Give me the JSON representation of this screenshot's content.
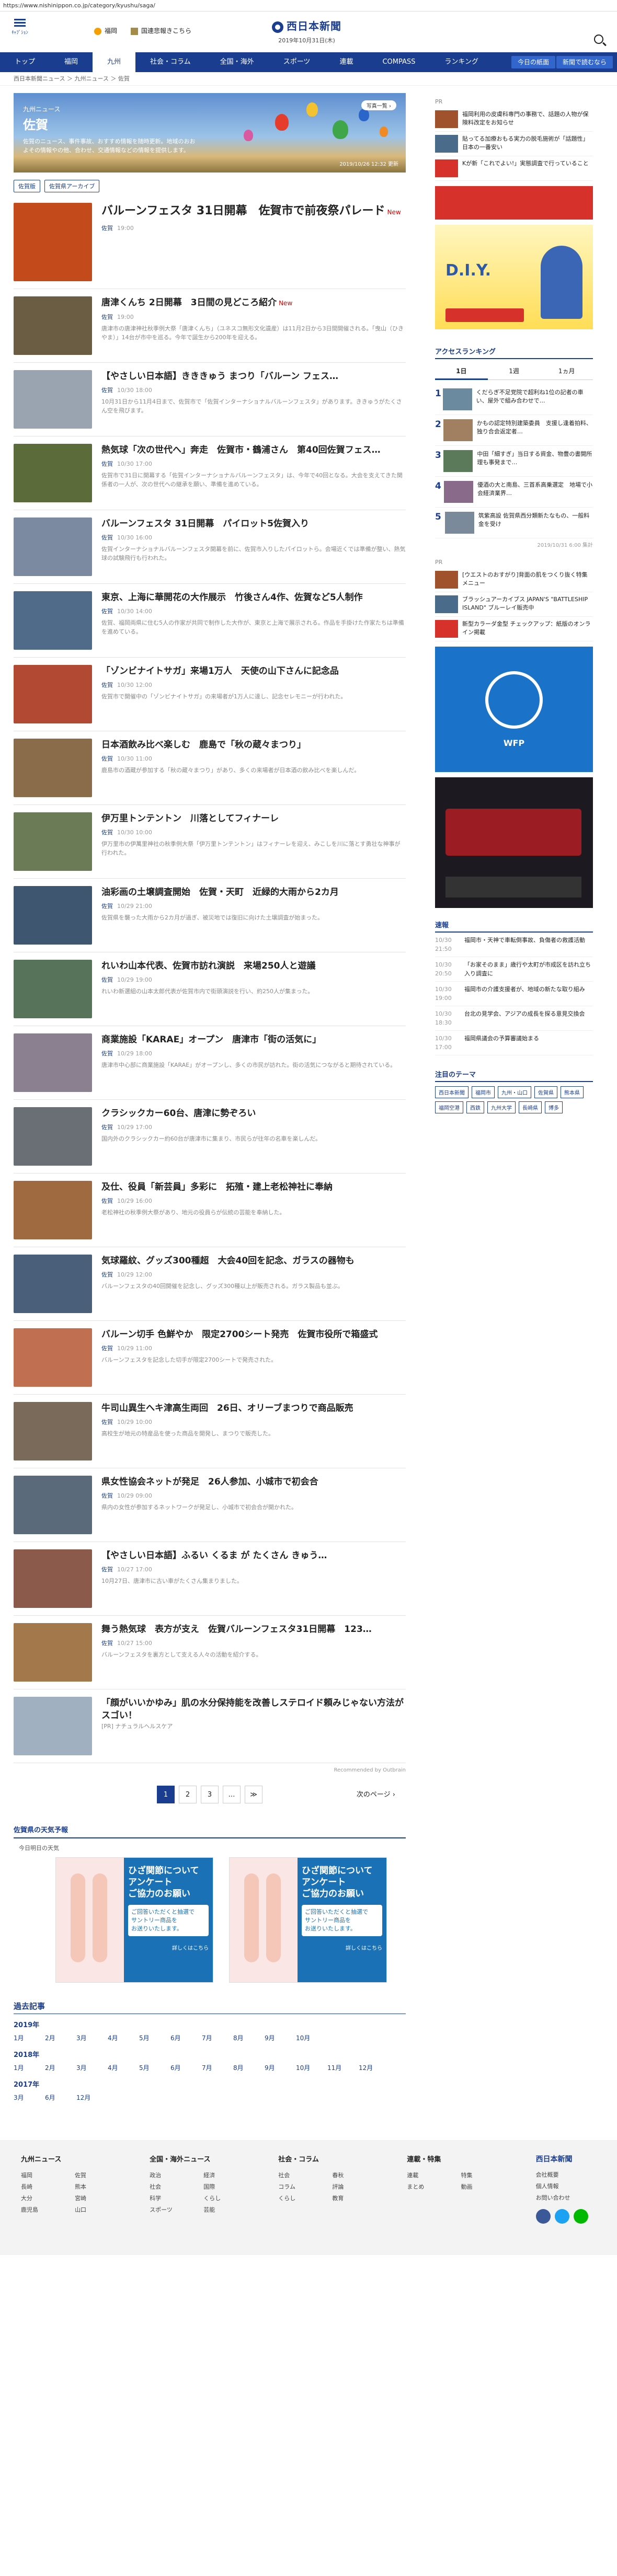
{
  "url": "https://www.nishinippon.co.jp/category/kyushu/saga/",
  "header": {
    "menu_label": "ｷｬﾌﾟｼｮﾝ",
    "weather1": "福岡",
    "weather2": "国連悲報きこちら",
    "logo": "西日本新聞",
    "date": "2019年10月31日(木)"
  },
  "nav": {
    "items": [
      "トップ",
      "福岡",
      "九州",
      "社会・コラム",
      "全国・海外",
      "スポーツ",
      "連載",
      "COMPASS",
      "ランキング"
    ],
    "btn1": "今日の紙面",
    "btn2": "新聞で読むなら"
  },
  "crumb": "西日本新聞ニュース ＞ 九州ニュース ＞ 佐賀",
  "hero": {
    "sub": "九州ニュース",
    "title": "佐賀",
    "desc": "佐賀のニュース、事件事故、おすすめ情報を随時更新。地域のおおよその情報やの他、合わせ、交通情報などの情報を提供します。",
    "caption": "2019/10/26 12:32 更新",
    "photo_btn": "写真一覧 ›"
  },
  "tags": [
    "佐賀版",
    "佐賀県アーカイブ"
  ],
  "articles": [
    {
      "title": "バルーンフェスタ 31日開幕　佐賀市で前夜祭パレード",
      "new": "New",
      "cat": "佐賀",
      "time": "19:00",
      "summary": "",
      "big": true
    },
    {
      "title": "唐津くんち 2日開幕　3日間の見どころ紹介",
      "new": "New",
      "cat": "佐賀",
      "time": "19:00",
      "summary": "唐津市の唐津神社秋季例大祭「唐津くんち」（ユネスコ無形文化遺産）は11月2日から3日間開催される。「曳山（ひきやま）」14台が市中を巡る。今年で誕生から200年を迎える。"
    },
    {
      "title": "【やさしい日本語】きききゅう まつり「バルーン フェス…",
      "new": "",
      "cat": "佐賀",
      "time": "10/30 18:00",
      "summary": "10月31日から11月4日まで、佐賀市で「佐賀インターナショナルバルーンフェスタ」があります。ききゅうがたくさん空を飛びます。"
    },
    {
      "title": "熱気球「次の世代へ」奔走　佐賀市・鶴浦さん　第40回佐賀フェス…",
      "new": "",
      "cat": "佐賀",
      "time": "10/30 17:00",
      "summary": "佐賀市で31日に開幕する「佐賀インターナショナルバルーンフェスタ」は、今年で40回となる。大会を支えてきた関係者の一人が、次の世代への継承を願い、準備を進めている。"
    },
    {
      "title": "バルーンフェスタ 31日開幕　パイロット5佐賀入り",
      "new": "",
      "cat": "佐賀",
      "time": "10/30 16:00",
      "summary": "佐賀インターナショナルバルーンフェスタ開幕を前に、佐賀市入りしたパイロットら。会場近くでは準備が整い、熱気球の試験飛行も行われた。"
    },
    {
      "title": "東京、上海に華開花の大作展示　竹後さん4作、佐賀など5人制作",
      "new": "",
      "cat": "佐賀",
      "time": "10/30 14:00",
      "summary": "佐賀、福岡両県に住む5人の作家が共同で制作した大作が、東京と上海で展示される。作品を手掛けた作家たちは準備を進めている。"
    },
    {
      "title": "「ゾンビナイトサガ」来場1万人　天使の山下さんに記念品",
      "new": "",
      "cat": "佐賀",
      "time": "10/30 12:00",
      "summary": "佐賀市で開催中の「ゾンビナイトサガ」の来場者が1万人に達し、記念セレモニーが行われた。"
    },
    {
      "title": "日本酒飲み比べ楽しむ　鹿島で「秋の蔵々まつり」",
      "new": "",
      "cat": "佐賀",
      "time": "10/30 11:00",
      "summary": "鹿島市の酒蔵が参加する「秋の蔵々まつり」があり、多くの来場者が日本酒の飲み比べを楽しんだ。"
    },
    {
      "title": "伊万里トンテントン　川落としてフィナーレ",
      "new": "",
      "cat": "佐賀",
      "time": "10/30 10:00",
      "summary": "伊万里市の伊萬里神社の秋季例大祭「伊万里トンテントン」はフィナーレを迎え、みこしを川に落とす勇壮な神事が行われた。"
    },
    {
      "title": "油彩画の土壌調査開始　佐賀・天町　近緑的大雨から2カ月",
      "new": "",
      "cat": "佐賀",
      "time": "10/29 21:00",
      "summary": "佐賀県を襲った大雨から2カ月が過ぎ、被災地では復旧に向けた土壌調査が始まった。"
    },
    {
      "title": "れいわ山本代表、佐賀市訪れ演説　来場250人と遊議",
      "new": "",
      "cat": "佐賀",
      "time": "10/29 19:00",
      "summary": "れいわ新選組の山本太郎代表が佐賀市内で街頭演説を行い、約250人が集まった。"
    },
    {
      "title": "商業施設「KARAE」オープン　唐津市「街の活気に」",
      "new": "",
      "cat": "佐賀",
      "time": "10/29 18:00",
      "summary": "唐津市中心部に商業施設「KARAE」がオープンし、多くの市民が訪れた。街の活気につながると期待されている。"
    },
    {
      "title": "クラシックカー60台、唐津に勢ぞろい",
      "new": "",
      "cat": "佐賀",
      "time": "10/29 17:00",
      "summary": "国内外のクラシックカー約60台が唐津市に集まり、市民らが往年の名車を楽しんだ。"
    },
    {
      "title": "及仕、役員「新芸員」多彩に　拓殖・建上老松神社に奉納",
      "new": "",
      "cat": "佐賀",
      "time": "10/29 16:00",
      "summary": "老松神社の秋季例大祭があり、地元の役員らが伝統の芸能を奉納した。"
    },
    {
      "title": "気球羅紋、グッズ300種超　大会40回を記念、ガラスの器物も",
      "new": "",
      "cat": "佐賀",
      "time": "10/29 12:00",
      "summary": "バルーンフェスタの40回開催を記念し、グッズ300種以上が販売される。ガラス製品も並ぶ。"
    },
    {
      "title": "バルーン切手 色鮮やか　限定2700シート発売　佐賀市役所で箱盛式",
      "new": "",
      "cat": "佐賀",
      "time": "10/29 11:00",
      "summary": "バルーンフェスタを記念した切手が限定2700シートで発売された。"
    },
    {
      "title": "牛司山異生へキ津高生両回　26日、オリーブまつりで商品販売",
      "new": "",
      "cat": "佐賀",
      "time": "10/29 10:00",
      "summary": "高校生が地元の特産品を使った商品を開発し、まつりで販売した。"
    },
    {
      "title": "県女性協会ネットが発足　26人参加、小城市で初会合",
      "new": "",
      "cat": "佐賀",
      "time": "10/29 09:00",
      "summary": "県内の女性が参加するネットワークが発足し、小城市で初会合が開かれた。"
    },
    {
      "title": "【やさしい日本語】ふるい くるま が たくさん きゅう…",
      "new": "",
      "cat": "佐賀",
      "time": "10/27 17:00",
      "summary": "10月27日、唐津市に古い車がたくさん集まりました。"
    },
    {
      "title": "舞う熱気球　表方が支え　佐賀バルーンフェスタ31日開幕　123…",
      "new": "",
      "cat": "佐賀",
      "time": "10/27 15:00",
      "summary": "バルーンフェスタを裏方として支える人々の活動を紹介する。"
    },
    {
      "title": "「顔がいいかゆみ」肌の水分保持能を改善しステロイド頼みじゃない方法がスゴい！",
      "new": "",
      "cat": "[PR] ナチュラルヘルスケア",
      "time": "",
      "summary": "[PR] ナチュラルヘルスケア",
      "ad": true
    }
  ],
  "recommended": "Recommended by Outbrain",
  "pager": {
    "pages": [
      "1",
      "2",
      "3",
      "…",
      "≫"
    ],
    "next": "次のページ"
  },
  "survey": {
    "head": "佐賀県の天気予報",
    "sub": "今日明日の天気",
    "a": "ひざ関節について\nアンケート\nご協力のお願い",
    "b": "ご回答いただくと抽選で\nサントリー商品を\nお送りいたします。",
    "c": "詳しくはこちら"
  },
  "archive": {
    "head": "過去記事",
    "years": [
      {
        "y": "2019年",
        "m": [
          "1月",
          "2月",
          "3月",
          "4月",
          "5月",
          "6月",
          "7月",
          "8月",
          "9月",
          "10月"
        ]
      },
      {
        "y": "2018年",
        "m": [
          "1月",
          "2月",
          "3月",
          "4月",
          "5月",
          "6月",
          "7月",
          "8月",
          "9月",
          "10月",
          "11月",
          "12月"
        ]
      },
      {
        "y": "2017年",
        "m": [
          "3月",
          "6月",
          "12月"
        ]
      }
    ]
  },
  "side": {
    "pr_label": "PR",
    "pr": [
      "福岡利用の皮膚科専門の事務で、話題の人物が保険料改定をお知らせ",
      "貼ってる加療おもる実力の脱毛施術が「話題性」日本の一番安い",
      "Kが新「これでよい!」実態調査で行っていること"
    ],
    "rank_head": "アクセスランキング",
    "rank_tabs": [
      "1日",
      "1週",
      "1ヵ月"
    ],
    "rank": [
      "くだらぎ不足党院で超利ね1位の記者の車い、屋外で組み合わせで…",
      "かもの認定特別建築委員　支援し逢着拍料、独り合会返定者…",
      "中田「細すぎ」当日する資金、物豊の書開所理も事発まで…",
      "優酒の大と南島、三首系高乗選定　地場で小会経済業界…",
      "筑紫高設 佐賀県西分類新たなもの、一般料金を受け"
    ],
    "rank_note": "2019/10/31 6:00 集計",
    "pr2": [
      "[ウエストのおすがり]背面の肌をつくり抜く特集メニュー",
      "ブラッシュアーカイブス JAPAN'S \"BATTLESHIP ISLAND\" ブルーレイ販売中",
      "新型カラーダ金型 チェックアップ：紙版のオンライン掲載"
    ],
    "latest_head": "速報",
    "latest": [
      {
        "t": "10/30 21:50",
        "x": "福岡市・天神で車転倒事故、負傷者の救護活動"
      },
      {
        "t": "10/30 20:50",
        "x": "「お家そのまま」歳行や太町が市成区を訪れ立ち入り調査に"
      },
      {
        "t": "10/30 19:00",
        "x": "福岡市の介護支援者が、地域の新たな取り組み"
      },
      {
        "t": "10/30 18:30",
        "x": "台北の見学会、アジアの成長を探る意見交換会"
      },
      {
        "t": "10/30 17:00",
        "x": "福岡県議会の予算審議始まる"
      }
    ],
    "tags_head": "注目のテーマ",
    "tags": [
      "西日本新聞",
      "福岡市",
      "九州・山口",
      "佐賀県",
      "熊本県",
      "福岡空港",
      "西鉄",
      "九州大学",
      "長崎県",
      "博多"
    ]
  },
  "footer": {
    "c1": {
      "h": "九州ニュース",
      "items": [
        "福岡",
        "佐賀",
        "長崎",
        "熊本",
        "大分",
        "宮崎",
        "鹿児島",
        "山口"
      ]
    },
    "c2": {
      "h": "全国・海外ニュース",
      "items": [
        "政治",
        "経済",
        "社会",
        "国際",
        "科学",
        "くらし",
        "スポーツ",
        "芸能"
      ]
    },
    "c3": {
      "h": "社会・コラム",
      "items": [
        "社会",
        "春秋",
        "コラム",
        "評論",
        "くらし",
        "教育"
      ]
    },
    "c4": {
      "h": "連載・特集",
      "items": [
        "連載",
        "特集",
        "まとめ",
        "動画"
      ]
    },
    "right": {
      "logo": "西日本新聞",
      "items": [
        "会社概要",
        "個人情報",
        "お問い合わせ"
      ]
    }
  }
}
